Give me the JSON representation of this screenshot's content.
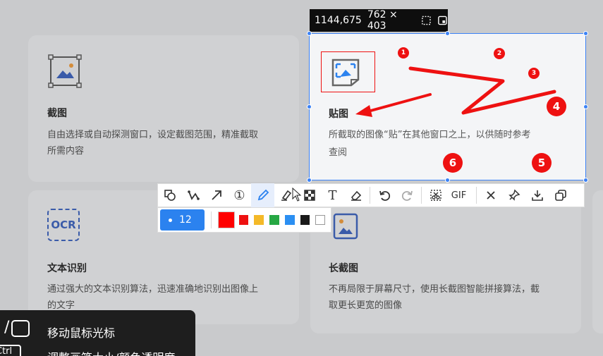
{
  "cards": [
    {
      "title": "截图",
      "desc1": "自由选择或自动探测窗口，设定截图范围，精准截取",
      "desc2": "所需内容",
      "icon": "screenshot-icon"
    },
    {
      "title": "文本识别",
      "desc1": "通过强大的文本识别算法，迅速准确地识别出图像上",
      "desc2": "的文字",
      "icon": "ocr-icon",
      "icon_text": "OCR"
    },
    {
      "title": "长截图",
      "desc1": "不再局限于屏幕尺寸，使用长截图智能拼接算法，截",
      "desc2": "取更长更宽的图像",
      "icon": "long-screenshot-icon"
    }
  ],
  "selection": {
    "coords": "1144,675",
    "size": "762 × 403",
    "card_title": "贴图",
    "card_desc1": "所截取的图像“贴”在其他窗口之上，以供随时参考",
    "card_desc2": "查阅",
    "icon": "pin-image-icon"
  },
  "badges": [
    "1",
    "2",
    "3",
    "4",
    "5",
    "6"
  ],
  "toolbar": {
    "tools": [
      "rectangle-tool",
      "polyline-tool",
      "arrow-tool",
      "number-tool",
      "pen-tool",
      "highlighter-tool",
      "mosaic-tool",
      "text-tool",
      "eraser-tool"
    ],
    "number_glyph": "①",
    "text_glyph": "T",
    "gif_label": "GIF",
    "pen_size": "12",
    "colors": [
      "#ff0000",
      "#ee1111",
      "#f4b928",
      "#27a844",
      "#2b8ff2",
      "#1a1a1a",
      "#ffffff"
    ],
    "selected_color": "#ff0000"
  },
  "hint": {
    "line1": "移动鼠标光标",
    "line2": "调整画笔大小/颜色透明度",
    "key_ctrl": "Ctrl"
  },
  "colors": {
    "accent": "#3b82f6",
    "annotation_red": "#ee1111"
  }
}
